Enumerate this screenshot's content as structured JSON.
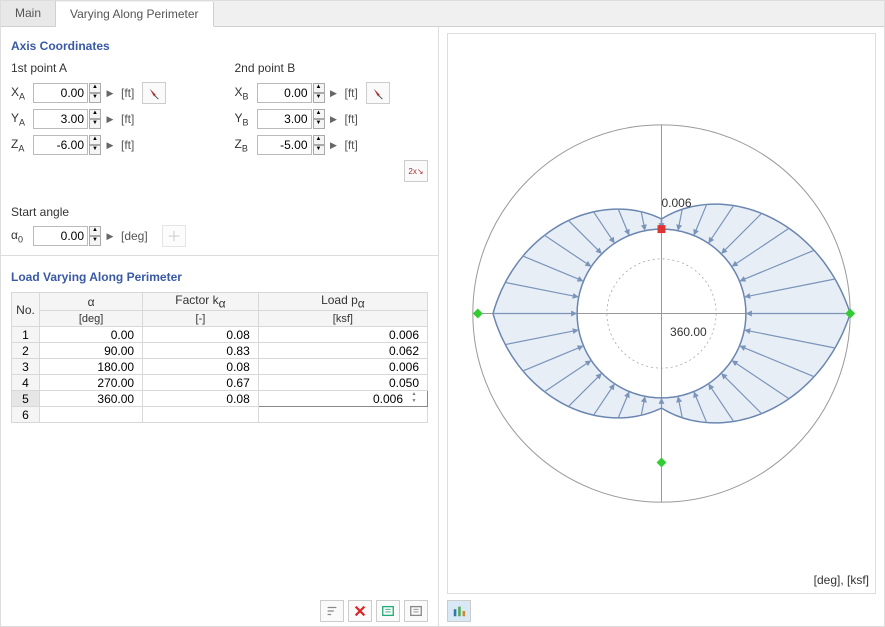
{
  "tabs": {
    "main": "Main",
    "vary": "Varying Along Perimeter"
  },
  "axis": {
    "section_title": "Axis Coordinates",
    "pointA_title": "1st point A",
    "pointB_title": "2nd point B",
    "labels": {
      "XA": "X",
      "YA": "Y",
      "ZA": "Z",
      "XB": "X",
      "YB": "Y",
      "ZB": "Z"
    },
    "XA": "0.00",
    "YA": "3.00",
    "ZA": "-6.00",
    "XB": "0.00",
    "YB": "3.00",
    "ZB": "-5.00",
    "unit": "[ft]"
  },
  "start_angle": {
    "title": "Start angle",
    "label": "α",
    "sub": "0",
    "value": "0.00",
    "unit": "[deg]"
  },
  "load_table": {
    "title": "Load Varying Along Perimeter",
    "headers": {
      "no": "No.",
      "alpha": "α",
      "alpha_unit": "[deg]",
      "factor": "Factor k",
      "factor_sub": "α",
      "factor_unit": "[-]",
      "load": "Load p",
      "load_sub": "α",
      "load_unit": "[ksf]"
    },
    "rows": [
      {
        "no": "1",
        "alpha": "0.00",
        "k": "0.08",
        "p": "0.006"
      },
      {
        "no": "2",
        "alpha": "90.00",
        "k": "0.83",
        "p": "0.062"
      },
      {
        "no": "3",
        "alpha": "180.00",
        "k": "0.08",
        "p": "0.006"
      },
      {
        "no": "4",
        "alpha": "270.00",
        "k": "0.67",
        "p": "0.050"
      },
      {
        "no": "5",
        "alpha": "360.00",
        "k": "0.08",
        "p": "0.006"
      },
      {
        "no": "6",
        "alpha": "",
        "k": "",
        "p": ""
      }
    ],
    "editing_row": 5
  },
  "chart_data": {
    "type": "polar-area",
    "title": "",
    "angle_unit": "deg",
    "value_unit": "ksf",
    "center_label": "360.00",
    "top_label": "0.006",
    "series": [
      {
        "name": "Load p_alpha",
        "angles_deg": [
          0,
          90,
          180,
          270,
          360
        ],
        "values": [
          0.006,
          0.062,
          0.006,
          0.05,
          0.006
        ]
      }
    ],
    "markers": [
      {
        "angle_deg": 0,
        "color": "#d33",
        "shape": "square"
      },
      {
        "angle_deg": 90,
        "color": "#3c3",
        "shape": "diamond"
      },
      {
        "angle_deg": 180,
        "color": "#3c3",
        "shape": "diamond"
      },
      {
        "angle_deg": 270,
        "color": "#3c3",
        "shape": "diamond"
      }
    ],
    "axis_label_br": "[deg], [ksf]"
  },
  "toolbar": {
    "sort": "sort",
    "delete": "delete",
    "import": "import",
    "export": "export",
    "chart_settings": "chart-settings"
  }
}
